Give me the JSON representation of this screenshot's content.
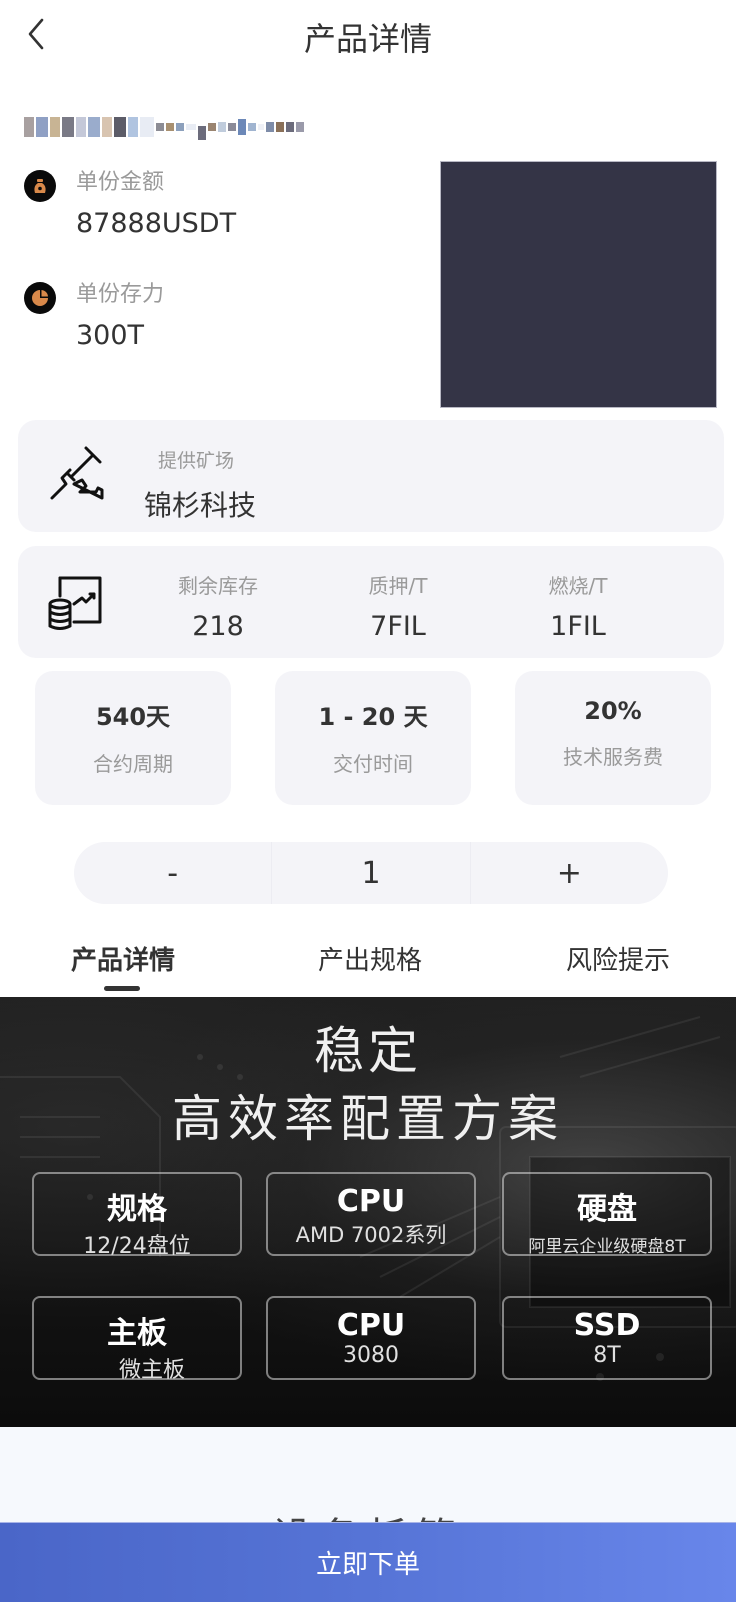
{
  "header": {
    "title": "产品详情",
    "back_icon": "chevron-left-icon"
  },
  "product": {
    "name_redacted": true,
    "price_label": "单份金额",
    "price_value": "87888USDT",
    "price_icon": "money-bag-icon",
    "storage_label": "单份存力",
    "storage_value": "300T",
    "storage_icon": "pie-chart-icon",
    "image_color": "#343446"
  },
  "farm": {
    "label": "提供矿场",
    "value": "锦杉科技",
    "icon": "pickaxe-icon"
  },
  "stock": {
    "icon": "database-chart-icon",
    "stats": [
      {
        "label": "剩余库存",
        "value": "218"
      },
      {
        "label": "质押/T",
        "value": "7FIL"
      },
      {
        "label": "燃烧/T",
        "value": "1FIL"
      }
    ]
  },
  "terms": [
    {
      "value": "540天",
      "label": "合约周期"
    },
    {
      "value": "1 - 20 天",
      "label": "交付时间"
    },
    {
      "value": "20%",
      "label": "技术服务费"
    }
  ],
  "quantity": {
    "minus": "-",
    "value": "1",
    "plus": "+"
  },
  "tabs": [
    {
      "label": "产品详情",
      "active": true
    },
    {
      "label": "产出规格",
      "active": false
    },
    {
      "label": "风险提示",
      "active": false
    }
  ],
  "banner": {
    "title_line1": "稳定",
    "title_line2": "高效率配置方案",
    "specs": [
      {
        "title": "规格",
        "sub": "12/24盘位"
      },
      {
        "title": "CPU",
        "sub": "AMD 7002系列"
      },
      {
        "title": "硬盘",
        "sub": "阿里云企业级硬盘8T"
      },
      {
        "title": "主板",
        "sub": "微主板"
      },
      {
        "title": "CPU",
        "sub": "3080"
      },
      {
        "title": "SSD",
        "sub": "8T"
      }
    ]
  },
  "lower_section": {
    "title_partial": "设备托管"
  },
  "order_button": {
    "label": "立即下单",
    "gradient_start": "#4a66c8",
    "gradient_end": "#6886ea"
  },
  "colors": {
    "card_bg": "#f4f4f8",
    "label_gray": "#9a9a9a",
    "text_dark": "#333333",
    "icon_accent": "#d9894a"
  }
}
